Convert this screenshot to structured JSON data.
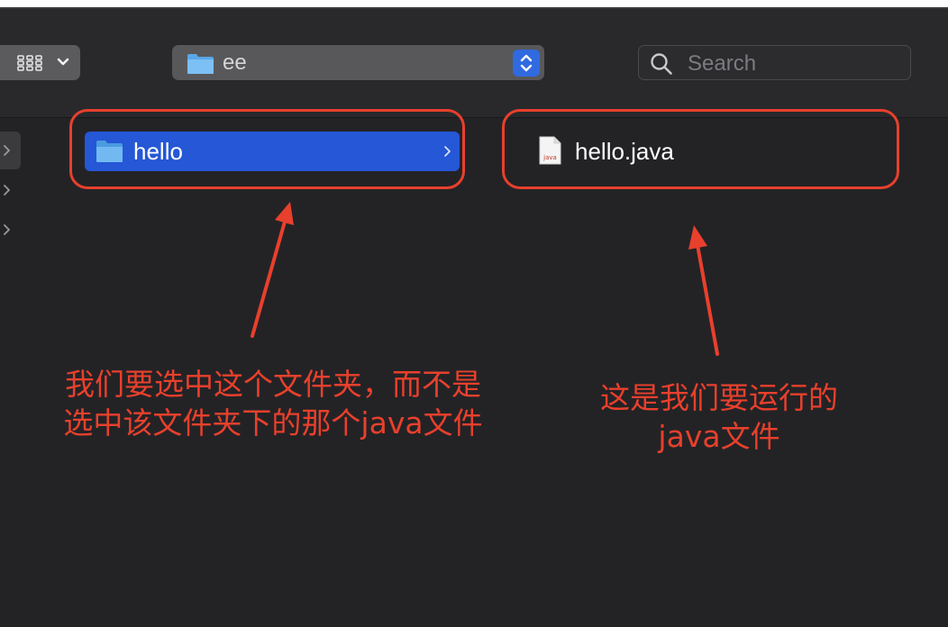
{
  "toolbar": {
    "view_mode_icon": "grid-icon",
    "path_popup": {
      "label": "ee",
      "icon": "folder-icon"
    },
    "search": {
      "placeholder": "Search",
      "value": ""
    }
  },
  "browser": {
    "items": [
      {
        "name": "hello",
        "type": "folder",
        "selected": true
      },
      {
        "name": "hello.java",
        "type": "java-file",
        "badge": "java"
      }
    ]
  },
  "annotations": {
    "left_text": [
      "我们要选中这个文件夹，而不是",
      "选中该文件夹下的那个java文件"
    ],
    "right_text": [
      "这是我们要运行的",
      "java文件"
    ],
    "color": "#e8402c"
  },
  "colors": {
    "selection": "#2557d6",
    "window_bg": "#232326",
    "accent_stepper": "#2f6ae0"
  }
}
